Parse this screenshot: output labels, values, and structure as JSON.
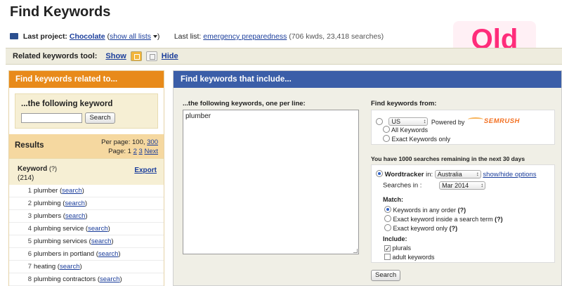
{
  "page": {
    "title": "Find Keywords"
  },
  "badge": {
    "text": "Old"
  },
  "last_bar": {
    "last_project_label": "Last project:",
    "project_name": "Chocolate",
    "show_all_lists": "show all lists",
    "last_list_label": "Last list:",
    "list_name": "emergency preparedness",
    "list_stats": "(706 kwds, 23,418 searches)"
  },
  "toolbar": {
    "label": "Related keywords tool:",
    "show": "Show",
    "hide": "Hide"
  },
  "left_panel": {
    "header": "Find keywords related to...",
    "keyword_title": "...the following keyword",
    "search_button": "Search",
    "results_title": "Results",
    "per_page_label": "Per page:",
    "per_page_current": "100,",
    "per_page_option": "300",
    "page_label": "Page:",
    "page_current": "1",
    "page_2": "2",
    "page_3": "3",
    "next": "Next",
    "column_keyword": "Keyword",
    "column_help": "(?)",
    "count": "(214)",
    "export": "Export",
    "search_link": "search",
    "keywords": [
      {
        "n": "1",
        "kw": "plumber"
      },
      {
        "n": "2",
        "kw": "plumbing"
      },
      {
        "n": "3",
        "kw": "plumbers"
      },
      {
        "n": "4",
        "kw": "plumbing service"
      },
      {
        "n": "5",
        "kw": "plumbing services"
      },
      {
        "n": "6",
        "kw": "plumbers in portland"
      },
      {
        "n": "7",
        "kw": "heating"
      },
      {
        "n": "8",
        "kw": "plumbing contractors"
      }
    ]
  },
  "right_panel": {
    "header": "Find keywords that include...",
    "textarea_label": "...the following keywords, one per line:",
    "textarea_value": "plumber",
    "source_label": "Find keywords from:",
    "semrush": {
      "country": "US",
      "powered_by": "Powered by",
      "logo": "SEMRUSH",
      "all_keywords": "All Keywords",
      "exact_only": "Exact Keywords only"
    },
    "remaining": "You have 1000 searches remaining in the next 30 days",
    "wordtracker": {
      "name": "Wordtracker",
      "in": "in:",
      "country": "Australia",
      "show_hide": "show/hide options",
      "searches_in_label": "Searches in :",
      "month": "Mar 2014",
      "match_label": "Match:",
      "match_any": "Keywords in any order",
      "match_inside": "Exact keyword inside a search term",
      "match_exact": "Exact keyword only",
      "help": "(?)",
      "include_label": "Include:",
      "plurals": "plurals",
      "adult": "adult keywords"
    },
    "search_button": "Search"
  },
  "colors": {
    "orange_header": "#e88a1a",
    "blue_header": "#3b5ea8",
    "badge": "#ff2c7a",
    "link": "#1a3d9b"
  }
}
